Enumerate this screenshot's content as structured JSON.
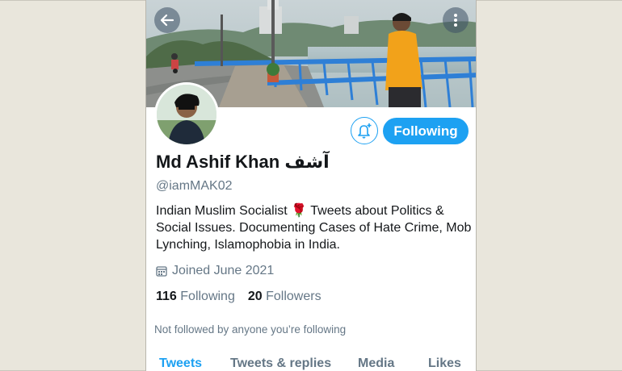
{
  "profile": {
    "name": "Md Ashif Khan",
    "name_suffix": "آشف",
    "handle": "@iamMAK02",
    "bio": "Indian Muslim Socialist 🌹 Tweets about Politics & Social Issues. Documenting Cases of Hate Crime, Mob Lynching, Islamophobia in India.",
    "joined": "Joined June 2021",
    "following_count": "116",
    "following_label": "Following",
    "followers_count": "20",
    "followers_label": "Followers",
    "not_followed_note": "Not followed by anyone you’re following"
  },
  "actions": {
    "follow_button_label": "Following",
    "notification_icon": "bell-plus-icon"
  },
  "header": {
    "back_icon": "arrow-left-icon",
    "more_icon": "more-vertical-icon"
  },
  "tabs": [
    {
      "label": "Tweets",
      "active": true
    },
    {
      "label": "Tweets & replies",
      "active": false
    },
    {
      "label": "Media",
      "active": false
    },
    {
      "label": "Likes",
      "active": false
    }
  ],
  "colors": {
    "accent": "#1da1f2",
    "text": "#14171a",
    "muted": "#657786"
  }
}
